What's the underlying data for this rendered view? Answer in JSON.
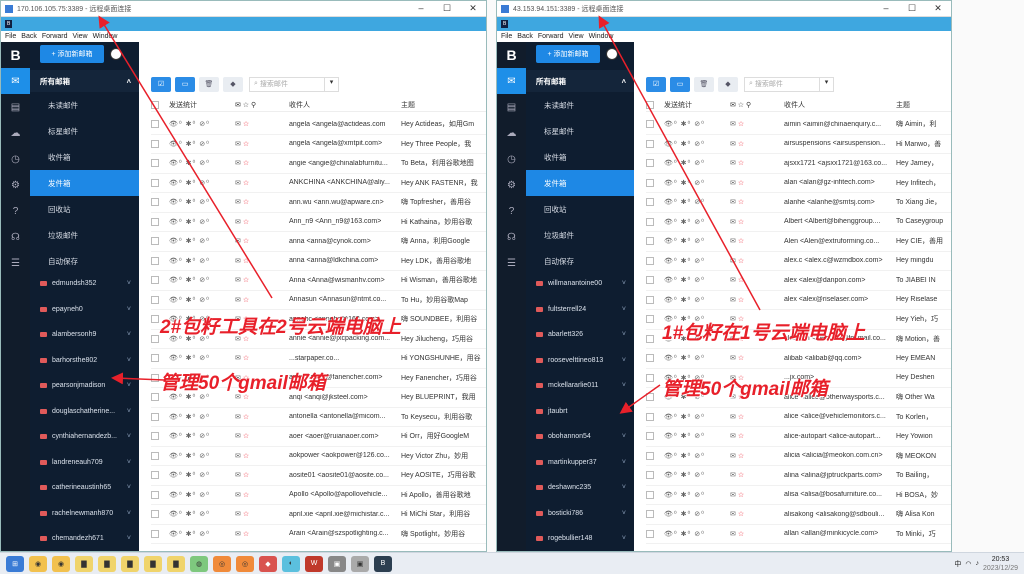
{
  "window1": {
    "title": "170.106.105.75:3389 - 远程桌面连接",
    "menu": [
      "File",
      "Back",
      "Forward",
      "View",
      "Window"
    ],
    "brand": "B",
    "add_button": "+ 添加新邮箱",
    "mailbox_header": "所有邮箱",
    "folders": [
      "未读邮件",
      "标星邮件",
      "收件箱",
      "发件箱",
      "回收站",
      "垃圾邮件",
      "自动保存"
    ],
    "accounts": [
      "edmundsh352",
      "epayneh0",
      "alambersonh9",
      "barhorsthe802",
      "pearsonjmadison",
      "douglaschatherine...",
      "cynthiahernandezb...",
      "landreneauh709",
      "catherineaustinh65",
      "rachelnewmanh870",
      "chemandezh671"
    ],
    "search_placeholder": "搜索邮件",
    "columns": {
      "stats": "发送统计",
      "recipient": "收件人",
      "subject": "主题"
    },
    "rows": [
      {
        "r": "angela <angela@actideas.com",
        "s": "Hey Actideas，如用Gm"
      },
      {
        "r": "angela <angela@xmtpit.com>",
        "s": "Hey Three People，我"
      },
      {
        "r": "angie <angie@chinalabfurnitu...",
        "s": "To Beta，利用谷歌地图"
      },
      {
        "r": "ANKCHINA <ANKCHINA@aliy...",
        "s": "Hey ANK FASTENR，我"
      },
      {
        "r": "ann.wu <ann.wu@apware.cn>",
        "s": "嗨 Topfresher，善用谷"
      },
      {
        "r": "Ann_n9 <Ann_n9@163.com>",
        "s": "Hi Kathaina，妙用谷歌"
      },
      {
        "r": "anna <anna@cynok.com>",
        "s": "嗨 Anna，利用Google"
      },
      {
        "r": "anna <anna@ldkchina.com>",
        "s": "Hey LDK，善用谷歌地"
      },
      {
        "r": "Anna <Anna@wismanhv.com>",
        "s": "Hi Wisman，善用谷歌地"
      },
      {
        "r": "Annasun <Annasun@ntmt.co...",
        "s": "To Hu，妙用谷歌Map"
      },
      {
        "r": "annebc <annebc@163.com>",
        "s": "嗨 SOUNDBEE，利用谷"
      },
      {
        "r": "annie <annie@jxcpacking.com...",
        "s": "Hey Jilucheng，巧用谷"
      },
      {
        "r": "...starpaper.co...",
        "s": "Hi YONGSHUNHE，用谷"
      },
      {
        "r": "anny <anny@fanencher.com>",
        "s": "Hey Fanencher，巧用谷"
      },
      {
        "r": "anqi <anqi@jksteel.com>",
        "s": "Hey BLUEPRINT，我用"
      },
      {
        "r": "antonella <antonella@micom...",
        "s": "To Keysecu，利用谷歌"
      },
      {
        "r": "aoer <aoer@ruianaoer.com>",
        "s": "Hi Orr，用好GoogleM"
      },
      {
        "r": "aokpower <aokpower@126.co...",
        "s": "Hey Victor Zhu，妙用"
      },
      {
        "r": "aosite01 <aosite01@aosite.co...",
        "s": "Hey AOSITE，巧用谷歌"
      },
      {
        "r": "Apollo <Apollo@apollovehicle...",
        "s": "Hi Apollo，善用谷歌地"
      },
      {
        "r": "april.xie <april.xie@michistar.c...",
        "s": "Hi MiChi Star，利用谷"
      },
      {
        "r": "Arain <Arain@szspotlighting.c...",
        "s": "嗨 Spotlight，妙用谷"
      }
    ]
  },
  "window2": {
    "title": "43.153.94.151:3389 - 远程桌面连接",
    "menu": [
      "File",
      "Back",
      "Forward",
      "View",
      "Window"
    ],
    "brand": "B",
    "add_button": "+ 添加新邮箱",
    "mailbox_header": "所有邮箱",
    "folders": [
      "未读邮件",
      "标星邮件",
      "收件箱",
      "发件箱",
      "回收站",
      "垃圾邮件",
      "自动保存"
    ],
    "accounts": [
      "willmanantoine00",
      "fultsterrell24",
      "abarlett326",
      "roosevelttineo813",
      "mckellararlie011",
      "jtaubrt",
      "obohannon54",
      "martinkupper37",
      "deshawnc235",
      "bosticki786",
      "rogebullier148"
    ],
    "search_placeholder": "搜索邮件",
    "columns": {
      "stats": "发送统计",
      "recipient": "收件人",
      "subject": "主题"
    },
    "rows": [
      {
        "r": "aimin <aimin@chinaenquiry.c...",
        "s": "嗨 Aimin，利"
      },
      {
        "r": "airsuspensions <airsuspension...",
        "s": "Hi Manwo，善"
      },
      {
        "r": "ajsxx1721 <ajsxx1721@163.co...",
        "s": "Hey Jamey，"
      },
      {
        "r": "alan <alan@gz-infitech.com>",
        "s": "Hey Infitech，"
      },
      {
        "r": "alanhe <alanhe@smtsj.com>",
        "s": "To Xiang Jie，"
      },
      {
        "r": "Albert <Albert@bihenggroup....",
        "s": "To Caseygroup"
      },
      {
        "r": "Alen <Alen@extruforming.co...",
        "s": "Hey CIE，善用"
      },
      {
        "r": "alex.c <alex.c@wzmdbox.com>",
        "s": "Hey mingdu"
      },
      {
        "r": "alex <alex@danpon.com>",
        "s": "To JIABEI IN"
      },
      {
        "r": "alex <alex@riselaser.com>",
        "s": "Hey Riselase"
      },
      {
        "r": "",
        "s": "Hey Yieh，巧"
      },
      {
        "r": "alexzcm <alexzcm@foxmail.co...",
        "s": "嗨 Motion，善"
      },
      {
        "r": "alibab <alibab@qq.com>",
        "s": "Hey EMEAN"
      },
      {
        "r": "...jx.com>",
        "s": "Hey Deshen"
      },
      {
        "r": "alice <alice@otherwaysports.c...",
        "s": "嗨 Other Wa"
      },
      {
        "r": "alice <alice@vehiclemonitors.c...",
        "s": "To Korlen，"
      },
      {
        "r": "alice-autopart <alice-autopart...",
        "s": "Hey Yowion"
      },
      {
        "r": "alicia <alicia@meokon.com.cn>",
        "s": "嗨 MEOKON"
      },
      {
        "r": "alina <alina@jptruckparts.com>",
        "s": "To Bailing，"
      },
      {
        "r": "alisa <alisa@bosafurniture.co...",
        "s": "Hi BOSA，妙"
      },
      {
        "r": "alisakong <alisakong@sdbouli...",
        "s": "嗨 Alisa Kon"
      },
      {
        "r": "allan <allan@minkicycle.com>",
        "s": "To Minki，巧"
      }
    ]
  },
  "annotations": {
    "left_tool": "2#包籽工具在2号云端电脑上",
    "left_manage": "管理50个gmail邮箱",
    "right_tool": "1#包籽在1号云端电脑上",
    "right_manage": "管理50个gmail邮箱"
  },
  "taskbar": {
    "time": "20:53",
    "date": "2023/12/29",
    "ime": "中"
  },
  "colors": {
    "accent": "#1e88e5",
    "annotation": "#e8202a",
    "sidebar": "#0e1d30"
  }
}
